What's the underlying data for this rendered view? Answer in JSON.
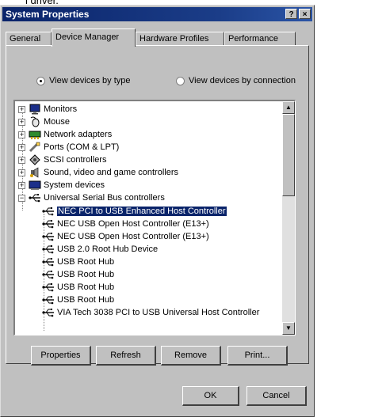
{
  "caption_fragment": "l driver.",
  "window": {
    "title": "System Properties",
    "help_btn": "?",
    "close_btn": "×"
  },
  "tabs": [
    {
      "label": "General",
      "active": false
    },
    {
      "label": "Device Manager",
      "active": true
    },
    {
      "label": "Hardware Profiles",
      "active": false
    },
    {
      "label": "Performance",
      "active": false
    }
  ],
  "view": {
    "by_type": "View devices by type",
    "by_connection": "View devices by connection",
    "selected": "by_type"
  },
  "devices": [
    {
      "label": "Monitors",
      "icon": "monitor-icon",
      "expander": "+"
    },
    {
      "label": "Mouse",
      "icon": "mouse-icon",
      "expander": "+"
    },
    {
      "label": "Network adapters",
      "icon": "network-icon",
      "expander": "+"
    },
    {
      "label": "Ports (COM & LPT)",
      "icon": "port-icon",
      "expander": "+"
    },
    {
      "label": "SCSI controllers",
      "icon": "scsi-icon",
      "expander": "+"
    },
    {
      "label": "Sound, video and game controllers",
      "icon": "sound-icon",
      "expander": "+"
    },
    {
      "label": "System devices",
      "icon": "system-icon",
      "expander": "+"
    },
    {
      "label": "Universal Serial Bus controllers",
      "icon": "usb-icon",
      "expander": "−"
    }
  ],
  "usb_children": [
    {
      "label": "NEC PCI to USB Enhanced Host Controller",
      "selected": true
    },
    {
      "label": "NEC USB Open Host Controller (E13+)",
      "selected": false
    },
    {
      "label": "NEC USB Open Host Controller (E13+)",
      "selected": false
    },
    {
      "label": "USB 2.0 Root Hub Device",
      "selected": false
    },
    {
      "label": "USB Root Hub",
      "selected": false
    },
    {
      "label": "USB Root Hub",
      "selected": false
    },
    {
      "label": "USB Root Hub",
      "selected": false
    },
    {
      "label": "USB Root Hub",
      "selected": false
    },
    {
      "label": "VIA Tech 3038 PCI to USB Universal Host Controller",
      "selected": false
    }
  ],
  "buttons": {
    "properties": "Properties",
    "refresh": "Refresh",
    "remove": "Remove",
    "print": "Print...",
    "ok": "OK",
    "cancel": "Cancel"
  },
  "colors": {
    "title_bar": "#0a246a",
    "selection": "#0a246a",
    "face": "#c0c0c0"
  }
}
